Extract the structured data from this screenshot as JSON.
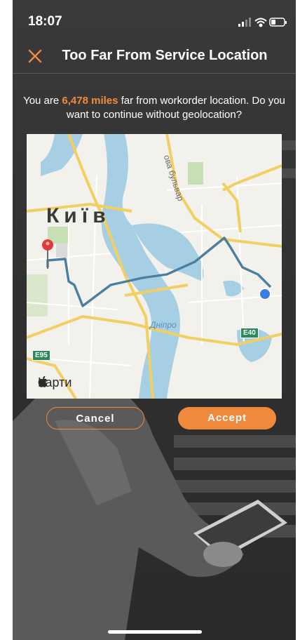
{
  "status_bar": {
    "time": "18:07"
  },
  "nav": {
    "title": "Too Far From Service Location",
    "close_icon": "close-x-icon"
  },
  "message": {
    "prefix": "You are ",
    "distance": "6,478 miles",
    "suffix": " far from workorder location. Do you want to continue without geolocation?"
  },
  "map": {
    "city": "Київ",
    "river": "Дніпро",
    "street": "ова бульвар",
    "road_e40": "E40",
    "road_e95": "E95",
    "brand": "Карти"
  },
  "buttons": {
    "cancel": "Cancel",
    "accept": "Accept"
  },
  "colors": {
    "accent": "#f08a3e",
    "route": "#4a7fa0",
    "water": "#a7cfe4"
  }
}
